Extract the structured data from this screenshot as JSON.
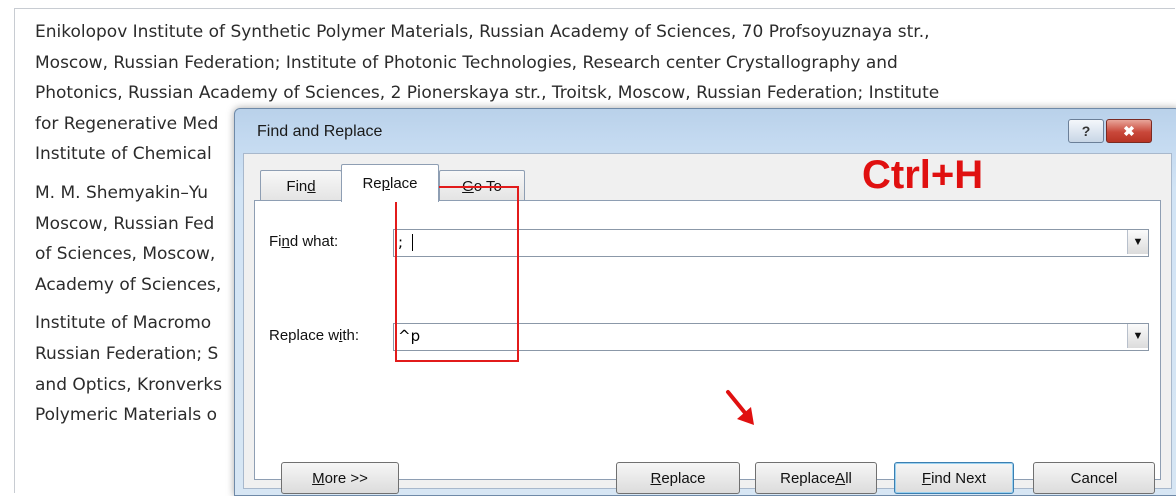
{
  "document": {
    "lines": [
      "Enikolopov Institute of Synthetic Polymer Materials, Russian Academy of Sciences, 70 Profsoyuznaya str.,",
      "Moscow, Russian Federation; Institute of Photonic Technologies, Research center Crystallography and",
      "Photonics, Russian Academy of Sciences, 2 Pionerskaya str., Troitsk, Moscow, Russian Federation; Institute",
      "for Regenerative Med",
      "Institute of Chemical",
      "M. M. Shemyakin–Yu",
      "Moscow, Russian Fed",
      "of Sciences, Moscow,",
      "Academy of Sciences,",
      "Institute of Macromo",
      "Russian Federation; S",
      "and Optics, Kronverks",
      "Polymeric Materials o"
    ]
  },
  "dialog": {
    "title": "Find and Replace",
    "help_glyph": "?",
    "close_glyph": "✖",
    "tabs": [
      {
        "pre": "Fin",
        "ul": "d",
        "post": ""
      },
      {
        "pre": "Re",
        "ul": "p",
        "post": "lace"
      },
      {
        "pre": "",
        "ul": "G",
        "post": "o To"
      }
    ],
    "find_label": {
      "pre": "Fi",
      "ul": "n",
      "post": "d what:"
    },
    "find_value": ";",
    "replace_label": {
      "pre": "Replace w",
      "ul": "i",
      "post": "th:"
    },
    "replace_value": "^p",
    "dropdown_glyph": "▼",
    "buttons": {
      "more": {
        "pre": "",
        "ul": "M",
        "post": "ore >>"
      },
      "replace": {
        "pre": "",
        "ul": "R",
        "post": "eplace"
      },
      "replace_all": {
        "pre": "Replace ",
        "ul": "A",
        "post": "ll"
      },
      "find_next": {
        "pre": "",
        "ul": "F",
        "post": "ind Next"
      },
      "cancel": "Cancel"
    }
  },
  "annotation": {
    "shortcut": "Ctrl+H",
    "color": "#e01010"
  }
}
